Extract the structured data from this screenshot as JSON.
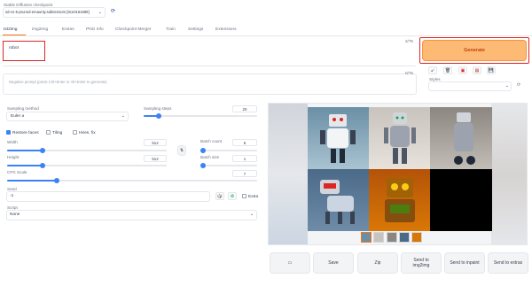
{
  "header": {
    "checkpoint_label": "Stable Diffusion checkpoint",
    "checkpoint_value": "sd-v1-5-pruned-emaonly.safetensors [6ce0161689]",
    "refresh_icon": "refresh-icon"
  },
  "tabs": [
    "txt2img",
    "img2img",
    "Extras",
    "PNG Info",
    "Checkpoint Merger",
    "Train",
    "Settings",
    "Extensions"
  ],
  "prompt": {
    "value": "robot",
    "counter": "2/75"
  },
  "negative": {
    "placeholder": "Negative prompt (press Ctrl+Enter or Alt+Enter to generate)",
    "counter": "0/75"
  },
  "generate_label": "Generate",
  "styles": {
    "label": "Styles"
  },
  "sampling": {
    "method_label": "Sampling method",
    "method_value": "Euler a",
    "steps_label": "Sampling steps",
    "steps_value": "20",
    "steps_fraction": 0.13
  },
  "checks": {
    "restore_faces": "Restore faces",
    "tiling": "Tiling",
    "hires_fix": "Hires. fix"
  },
  "size": {
    "width_label": "Width",
    "width_value": "512",
    "width_fraction": 0.22,
    "height_label": "Height",
    "height_value": "512",
    "height_fraction": 0.22,
    "swap_icon": "swap-icon"
  },
  "batch": {
    "count_label": "Batch count",
    "count_value": "6",
    "count_fraction": 0.05,
    "size_label": "Batch size",
    "size_value": "1",
    "size_fraction": 0.0
  },
  "cfg": {
    "label": "CFG Scale",
    "value": "7",
    "fraction": 0.2
  },
  "seed": {
    "label": "Seed",
    "value": "-1",
    "extra_label": "Extra"
  },
  "script": {
    "label": "Script",
    "value": "None"
  },
  "output_buttons": [
    "Save",
    "Zip",
    "Send to img2img",
    "Send to inpaint",
    "Send to extras"
  ],
  "icons": {
    "folder": "folder-icon",
    "dice": "dice-icon",
    "recycle": "recycle-icon",
    "paste": "paste-icon",
    "trash": "trash-icon",
    "style_apply": "style-apply-icon",
    "style_save": "save-style-icon",
    "dropdown": "chevron-down-icon"
  },
  "colors": {
    "accent": "#3b82f6",
    "generate_bg": "#fdba74",
    "generate_text": "#c2410c",
    "highlight": "#dc2626"
  }
}
